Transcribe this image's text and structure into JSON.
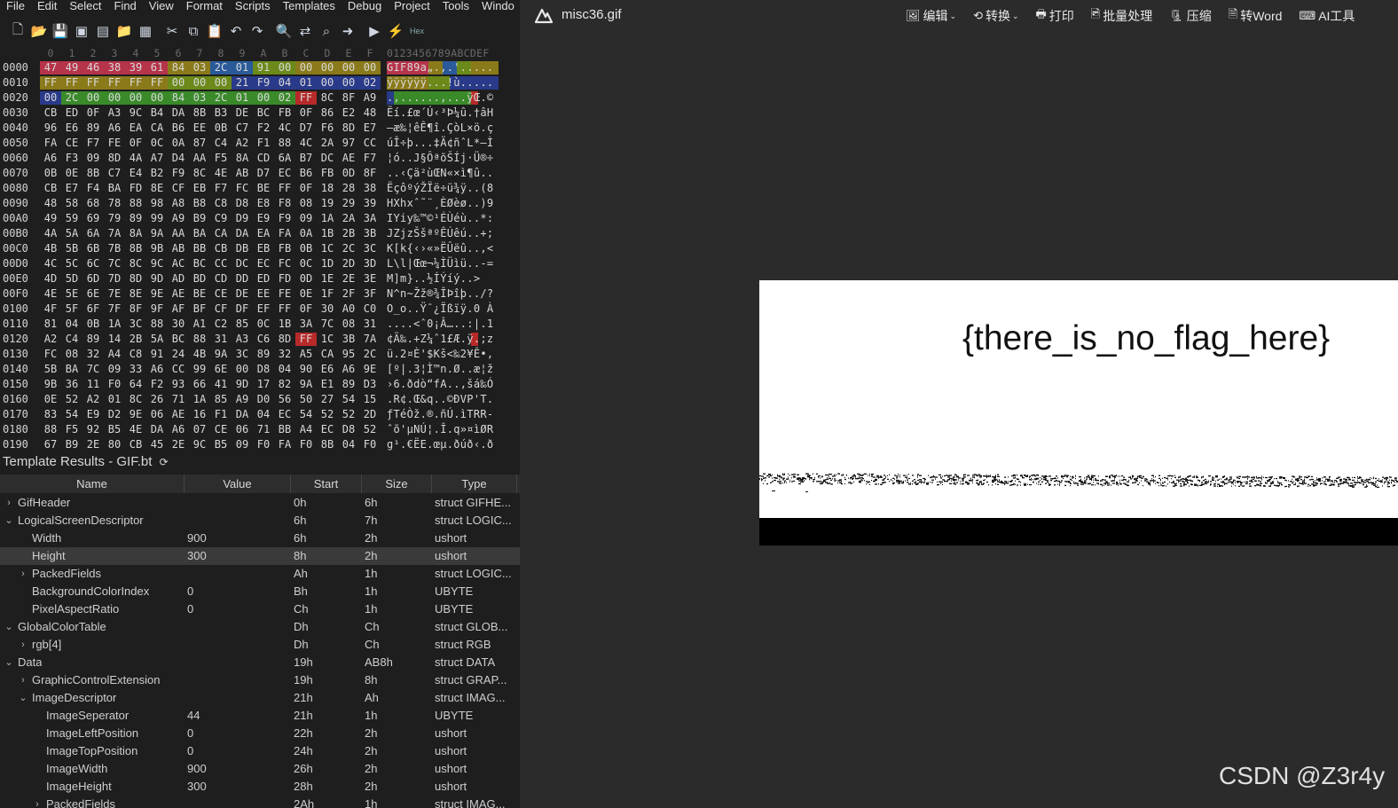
{
  "menu": [
    "File",
    "Edit",
    "Select",
    "Find",
    "View",
    "Format",
    "Scripts",
    "Templates",
    "Debug",
    "Project",
    "Tools",
    "Windo"
  ],
  "hex_columns": [
    "0",
    "1",
    "2",
    "3",
    "4",
    "5",
    "6",
    "7",
    "8",
    "9",
    "A",
    "B",
    "C",
    "D",
    "E",
    "F"
  ],
  "ascii_header": "0123456789ABCDEF",
  "hex_rows": [
    {
      "off": "0000",
      "bytes": [
        "47",
        "49",
        "46",
        "38",
        "39",
        "61",
        "84",
        "03",
        "2C",
        "01",
        "91",
        "00",
        "00",
        "00",
        "00",
        "00"
      ],
      "ascii": "GIF89a„.,.'....."
    },
    {
      "off": "0010",
      "bytes": [
        "FF",
        "FF",
        "FF",
        "FF",
        "FF",
        "FF",
        "00",
        "00",
        "00",
        "21",
        "F9",
        "04",
        "01",
        "00",
        "00",
        "02"
      ],
      "ascii": "ÿÿÿÿÿÿ...!ù....."
    },
    {
      "off": "0020",
      "bytes": [
        "00",
        "2C",
        "00",
        "00",
        "00",
        "00",
        "84",
        "03",
        "2C",
        "01",
        "00",
        "02",
        "FF",
        "8C",
        "8F",
        "A9"
      ],
      "ascii": ".,......,...ÿŒ.©"
    },
    {
      "off": "0030",
      "bytes": [
        "CB",
        "ED",
        "0F",
        "A3",
        "9C",
        "B4",
        "DA",
        "8B",
        "B3",
        "DE",
        "BC",
        "FB",
        "0F",
        "86",
        "E2",
        "48"
      ],
      "ascii": "Ëí.£œ´Ú‹³Þ¼û.†âH"
    },
    {
      "off": "0040",
      "bytes": [
        "96",
        "E6",
        "89",
        "A6",
        "EA",
        "CA",
        "B6",
        "EE",
        "0B",
        "C7",
        "F2",
        "4C",
        "D7",
        "F6",
        "8D",
        "E7"
      ],
      "ascii": "–æ‰¦êÊ¶î.ÇòL×ö.ç"
    },
    {
      "off": "0050",
      "bytes": [
        "FA",
        "CE",
        "F7",
        "FE",
        "0F",
        "0C",
        "0A",
        "87",
        "C4",
        "A2",
        "F1",
        "88",
        "4C",
        "2A",
        "97",
        "CC"
      ],
      "ascii": "úÎ÷þ...‡Ä¢ñˆL*—Ì"
    },
    {
      "off": "0060",
      "bytes": [
        "A6",
        "F3",
        "09",
        "8D",
        "4A",
        "A7",
        "D4",
        "AA",
        "F5",
        "8A",
        "CD",
        "6A",
        "B7",
        "DC",
        "AE",
        "F7"
      ],
      "ascii": "¦ó..J§ÔªõŠÍj·Ü®÷"
    },
    {
      "off": "0070",
      "bytes": [
        "0B",
        "0E",
        "8B",
        "C7",
        "E4",
        "B2",
        "F9",
        "8C",
        "4E",
        "AB",
        "D7",
        "EC",
        "B6",
        "FB",
        "0D",
        "8F"
      ],
      "ascii": "..‹Çä²ùŒN«×ì¶û.."
    },
    {
      "off": "0080",
      "bytes": [
        "CB",
        "E7",
        "F4",
        "BA",
        "FD",
        "8E",
        "CF",
        "EB",
        "F7",
        "FC",
        "BE",
        "FF",
        "0F",
        "18",
        "28",
        "38"
      ],
      "ascii": "ËçôºýŽÏë÷ü¾ÿ..(8"
    },
    {
      "off": "0090",
      "bytes": [
        "48",
        "58",
        "68",
        "78",
        "88",
        "98",
        "A8",
        "B8",
        "C8",
        "D8",
        "E8",
        "F8",
        "08",
        "19",
        "29",
        "39"
      ],
      "ascii": "HXhxˆ˜¨¸ÈØèø..)9"
    },
    {
      "off": "00A0",
      "bytes": [
        "49",
        "59",
        "69",
        "79",
        "89",
        "99",
        "A9",
        "B9",
        "C9",
        "D9",
        "E9",
        "F9",
        "09",
        "1A",
        "2A",
        "3A"
      ],
      "ascii": "IYiy‰™©¹ÉÙéù..*:"
    },
    {
      "off": "00B0",
      "bytes": [
        "4A",
        "5A",
        "6A",
        "7A",
        "8A",
        "9A",
        "AA",
        "BA",
        "CA",
        "DA",
        "EA",
        "FA",
        "0A",
        "1B",
        "2B",
        "3B"
      ],
      "ascii": "JZjzŠšªºÊÚêú..+;"
    },
    {
      "off": "00C0",
      "bytes": [
        "4B",
        "5B",
        "6B",
        "7B",
        "8B",
        "9B",
        "AB",
        "BB",
        "CB",
        "DB",
        "EB",
        "FB",
        "0B",
        "1C",
        "2C",
        "3C"
      ],
      "ascii": "K[k{‹›«»ËÛëû..,<"
    },
    {
      "off": "00D0",
      "bytes": [
        "4C",
        "5C",
        "6C",
        "7C",
        "8C",
        "9C",
        "AC",
        "BC",
        "CC",
        "DC",
        "EC",
        "FC",
        "0C",
        "1D",
        "2D",
        "3D"
      ],
      "ascii": "L\\l|Œœ¬¼ÌÜìü..-="
    },
    {
      "off": "00E0",
      "bytes": [
        "4D",
        "5D",
        "6D",
        "7D",
        "8D",
        "9D",
        "AD",
        "BD",
        "CD",
        "DD",
        "ED",
        "FD",
        "0D",
        "1E",
        "2E",
        "3E"
      ],
      "ascii": "M]m}..­½ÍÝíý..>"
    },
    {
      "off": "00F0",
      "bytes": [
        "4E",
        "5E",
        "6E",
        "7E",
        "8E",
        "9E",
        "AE",
        "BE",
        "CE",
        "DE",
        "EE",
        "FE",
        "0E",
        "1F",
        "2F",
        "3F"
      ],
      "ascii": "N^n~Žž®¾ÎÞîþ../?"
    },
    {
      "off": "0100",
      "bytes": [
        "4F",
        "5F",
        "6F",
        "7F",
        "8F",
        "9F",
        "AF",
        "BF",
        "CF",
        "DF",
        "EF",
        "FF",
        "0F",
        "30",
        "A0",
        "C0"
      ],
      "ascii": "O_o..Ÿ¯¿Ïßïÿ.0 À"
    },
    {
      "off": "0110",
      "bytes": [
        "81",
        "04",
        "0B",
        "1A",
        "3C",
        "88",
        "30",
        "A1",
        "C2",
        "85",
        "0C",
        "1B",
        "3A",
        "7C",
        "08",
        "31"
      ],
      "ascii": "....<ˆ0¡Â…..:|.1"
    },
    {
      "off": "0120",
      "bytes": [
        "A2",
        "C4",
        "89",
        "14",
        "2B",
        "5A",
        "BC",
        "88",
        "31",
        "A3",
        "C6",
        "8D",
        "FF",
        "1C",
        "3B",
        "7A"
      ],
      "ascii": "¢Ä‰.+Z¼ˆ1£Æ.ÿ.;z"
    },
    {
      "off": "0130",
      "bytes": [
        "FC",
        "08",
        "32",
        "A4",
        "C8",
        "91",
        "24",
        "4B",
        "9A",
        "3C",
        "89",
        "32",
        "A5",
        "CA",
        "95",
        "2C"
      ],
      "ascii": "ü.2¤È'$Kš<‰2¥Ê•,"
    },
    {
      "off": "0140",
      "bytes": [
        "5B",
        "BA",
        "7C",
        "09",
        "33",
        "A6",
        "CC",
        "99",
        "6E",
        "00",
        "D8",
        "04",
        "90",
        "E6",
        "A6",
        "9E"
      ],
      "ascii": "[º|.3¦Ì™n.Ø..æ¦ž"
    },
    {
      "off": "0150",
      "bytes": [
        "9B",
        "36",
        "11",
        "F0",
        "64",
        "F2",
        "93",
        "66",
        "41",
        "9D",
        "17",
        "82",
        "9A",
        "E1",
        "89",
        "D3"
      ],
      "ascii": "›6.ðdò“fA..‚šá‰Ó"
    },
    {
      "off": "0160",
      "bytes": [
        "0E",
        "52",
        "A2",
        "01",
        "8C",
        "26",
        "71",
        "1A",
        "85",
        "A9",
        "D0",
        "56",
        "50",
        "27",
        "54",
        "15"
      ],
      "ascii": ".R¢.Œ&q..©ÐVP'T."
    },
    {
      "off": "0170",
      "bytes": [
        "83",
        "54",
        "E9",
        "D2",
        "9E",
        "06",
        "AE",
        "16",
        "F1",
        "DA",
        "04",
        "EC",
        "54",
        "52",
        "52",
        "2D"
      ],
      "ascii": "ƒTéÒž.®.ñÚ.ìTRR-"
    },
    {
      "off": "0180",
      "bytes": [
        "88",
        "F5",
        "92",
        "B5",
        "4E",
        "DA",
        "A6",
        "07",
        "CE",
        "06",
        "71",
        "BB",
        "A4",
        "EC",
        "D8",
        "52"
      ],
      "ascii": "ˆõ'µNÚ¦.Î.q»¤ìØR"
    },
    {
      "off": "0190",
      "bytes": [
        "67",
        "B9",
        "2E",
        "80",
        "CB",
        "45",
        "2E",
        "9C",
        "B5",
        "09",
        "F0",
        "FA",
        "F0",
        "8B",
        "04",
        "F0"
      ],
      "ascii": "g¹.€ËE.œµ.ðúð‹.ð"
    }
  ],
  "highlight_colors": {
    "red": "#b5344a",
    "gold": "#8a7a1a",
    "olive": "#6b8a1a",
    "blue": "#2a5a9a",
    "navy": "#2a3a8a",
    "green": "#3a8a2a",
    "bright_red": "#b82a2a"
  },
  "template": {
    "title": "Template Results - GIF.bt",
    "refresh_icon": "refresh-icon",
    "headers": [
      "Name",
      "Value",
      "Start",
      "Size",
      "Type"
    ],
    "rows": [
      {
        "indent": 0,
        "arrow": "›",
        "name": "GifHeader",
        "value": "",
        "start": "0h",
        "size": "6h",
        "type": "struct GIFHE..."
      },
      {
        "indent": 0,
        "arrow": "⌄",
        "name": "LogicalScreenDescriptor",
        "value": "",
        "start": "6h",
        "size": "7h",
        "type": "struct LOGIC..."
      },
      {
        "indent": 1,
        "arrow": "",
        "name": "Width",
        "value": "900",
        "start": "6h",
        "size": "2h",
        "type": "ushort"
      },
      {
        "indent": 1,
        "arrow": "",
        "name": "Height",
        "value": "300",
        "start": "8h",
        "size": "2h",
        "type": "ushort",
        "selected": true
      },
      {
        "indent": 1,
        "arrow": "›",
        "name": "PackedFields",
        "value": "",
        "start": "Ah",
        "size": "1h",
        "type": "struct LOGIC..."
      },
      {
        "indent": 1,
        "arrow": "",
        "name": "BackgroundColorIndex",
        "value": "0",
        "start": "Bh",
        "size": "1h",
        "type": "UBYTE"
      },
      {
        "indent": 1,
        "arrow": "",
        "name": "PixelAspectRatio",
        "value": "0",
        "start": "Ch",
        "size": "1h",
        "type": "UBYTE"
      },
      {
        "indent": 0,
        "arrow": "⌄",
        "name": "GlobalColorTable",
        "value": "",
        "start": "Dh",
        "size": "Ch",
        "type": "struct GLOB..."
      },
      {
        "indent": 1,
        "arrow": "›",
        "name": "rgb[4]",
        "value": "",
        "start": "Dh",
        "size": "Ch",
        "type": "struct RGB"
      },
      {
        "indent": 0,
        "arrow": "⌄",
        "name": "Data",
        "value": "",
        "start": "19h",
        "size": "AB8h",
        "type": "struct DATA"
      },
      {
        "indent": 1,
        "arrow": "›",
        "name": "GraphicControlExtension",
        "value": "",
        "start": "19h",
        "size": "8h",
        "type": "struct GRAP..."
      },
      {
        "indent": 1,
        "arrow": "⌄",
        "name": "ImageDescriptor",
        "value": "",
        "start": "21h",
        "size": "Ah",
        "type": "struct IMAG..."
      },
      {
        "indent": 2,
        "arrow": "",
        "name": "ImageSeperator",
        "value": "44",
        "start": "21h",
        "size": "1h",
        "type": "UBYTE"
      },
      {
        "indent": 2,
        "arrow": "",
        "name": "ImageLeftPosition",
        "value": "0",
        "start": "22h",
        "size": "2h",
        "type": "ushort"
      },
      {
        "indent": 2,
        "arrow": "",
        "name": "ImageTopPosition",
        "value": "0",
        "start": "24h",
        "size": "2h",
        "type": "ushort"
      },
      {
        "indent": 2,
        "arrow": "",
        "name": "ImageWidth",
        "value": "900",
        "start": "26h",
        "size": "2h",
        "type": "ushort"
      },
      {
        "indent": 2,
        "arrow": "",
        "name": "ImageHeight",
        "value": "300",
        "start": "28h",
        "size": "2h",
        "type": "ushort"
      },
      {
        "indent": 2,
        "arrow": "›",
        "name": "PackedFields",
        "value": "",
        "start": "2Ah",
        "size": "1h",
        "type": "struct IMAG..."
      }
    ]
  },
  "viewer": {
    "filename": "misc36.gif",
    "buttons": [
      {
        "icon": "edit-icon",
        "label": "编辑",
        "dropdown": true
      },
      {
        "icon": "convert-icon",
        "label": "转换",
        "dropdown": true
      },
      {
        "icon": "print-icon",
        "label": "打印",
        "dropdown": false
      },
      {
        "icon": "batch-icon",
        "label": "批量处理",
        "dropdown": false
      },
      {
        "icon": "compress-icon",
        "label": "压缩",
        "dropdown": false
      },
      {
        "icon": "word-icon",
        "label": "转Word",
        "dropdown": false
      },
      {
        "icon": "ai-icon",
        "label": "AI工具",
        "dropdown": false
      }
    ],
    "gif_text": "{there_is_no_flag_here}",
    "watermark": "CSDN @Z3r4y"
  }
}
